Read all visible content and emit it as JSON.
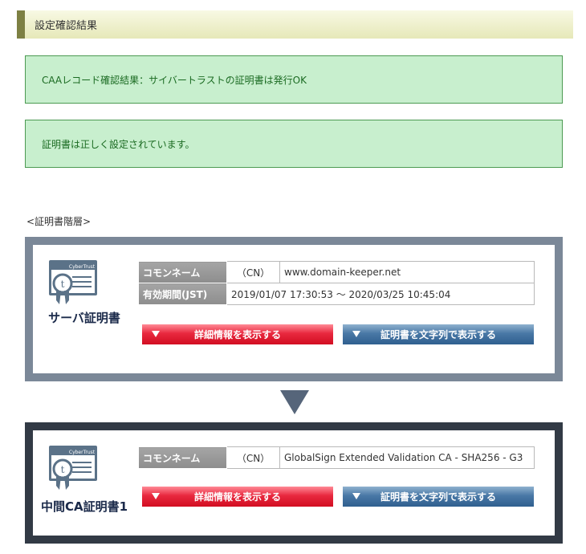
{
  "header": {
    "title": "設定確認結果"
  },
  "messages": [
    "CAAレコード確認結果：サイバートラストの証明書は発行OK",
    "証明書は正しく設定されています。"
  ],
  "hierarchy_label": "<証明書階層>",
  "certs": [
    {
      "title": "サーバ証明書",
      "icon_text": "CyberTrust",
      "rows": [
        {
          "key": "コモンネーム",
          "sub": "（CN）",
          "value": "www.domain-keeper.net"
        },
        {
          "key": "有効期間(JST)",
          "value": "2019/01/07 17:30:53 ～ 2020/03/25 10:45:04"
        }
      ],
      "btn_detail": "詳細情報を表示する",
      "btn_text": "証明書を文字列で表示する",
      "frame_color": "#7b8898"
    },
    {
      "title": "中間CA証明書1",
      "icon_text": "CyberTrust",
      "rows": [
        {
          "key": "コモンネーム",
          "sub": "（CN）",
          "value": "GlobalSign Extended Validation CA - SHA256 - G3"
        }
      ],
      "btn_detail": "詳細情報を表示する",
      "btn_text": "証明書を文字列で表示する",
      "frame_color": "#323a45"
    }
  ],
  "colors": {
    "success_bg": "#c8efce",
    "success_text": "#1b6b22",
    "red_btn": "#d20e22",
    "blue_btn": "#2f5f8f"
  }
}
